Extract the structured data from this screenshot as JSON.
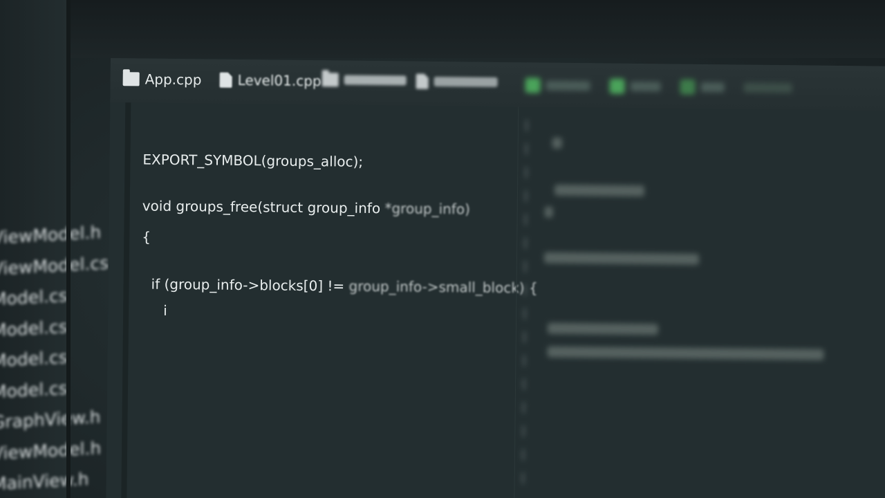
{
  "tabs": [
    {
      "label": "App.cpp",
      "icon": "folder-icon"
    },
    {
      "label": "Level01.cpp",
      "icon": "file-icon"
    }
  ],
  "code": {
    "line1": "EXPORT_SYMBOL(groups_alloc);",
    "line2": "void groups_free(struct group_info ",
    "line2_faded": "*group_info)",
    "line3": "{",
    "line4": "if (group_info->blocks[0] != ",
    "line4_faded": "group_info->small_block) {",
    "line5": "i"
  }
}
